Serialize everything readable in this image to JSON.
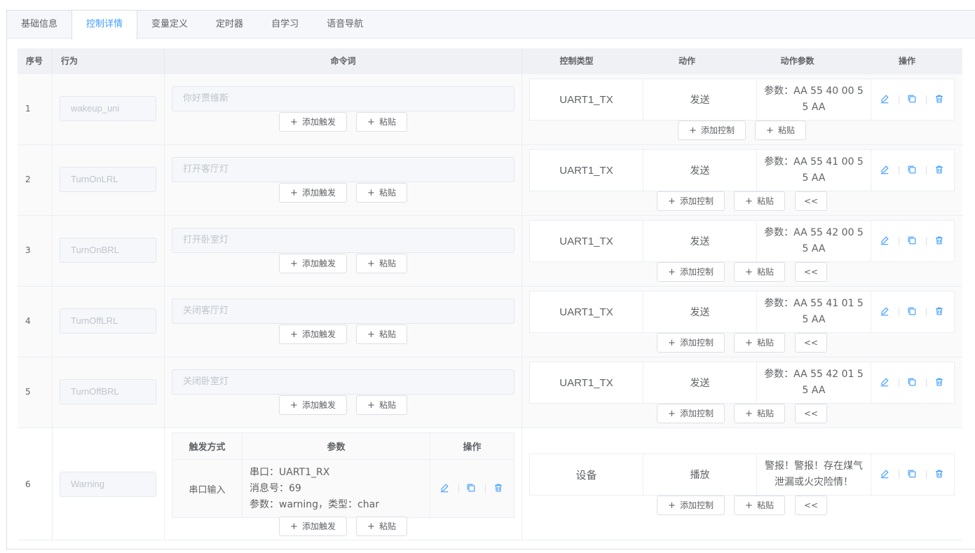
{
  "tabs": [
    "基础信息",
    "控制详情",
    "变量定义",
    "定时器",
    "自学习",
    "语音导航"
  ],
  "active_tab": 1,
  "table_headers": {
    "seq": "序号",
    "behavior": "行为",
    "command": "命令词",
    "control_type": "控制类型",
    "action": "动作",
    "action_params": "动作参数",
    "operations": "操作"
  },
  "buttons": {
    "add_trigger": "添加触发",
    "paste": "粘贴",
    "add_control": "添加控制",
    "collapse": "<<"
  },
  "rows": [
    {
      "seq": "1",
      "behavior": "wakeup_uni",
      "command": "你好贾维斯",
      "control_type": "UART1_TX",
      "action": "发送",
      "params": "参数：AA 55 40 00 5 5 AA"
    },
    {
      "seq": "2",
      "behavior": "TurnOnLRL",
      "command": "打开客厅灯",
      "control_type": "UART1_TX",
      "action": "发送",
      "params": "参数：AA 55 41 00 5 5 AA"
    },
    {
      "seq": "3",
      "behavior": "TurnOnBRL",
      "command": "打开卧室灯",
      "control_type": "UART1_TX",
      "action": "发送",
      "params": "参数：AA 55 42 00 5 5 AA"
    },
    {
      "seq": "4",
      "behavior": "TurnOffLRL",
      "command": "关闭客厅灯",
      "control_type": "UART1_TX",
      "action": "发送",
      "params": "参数：AA 55 41 01 5 5 AA"
    },
    {
      "seq": "5",
      "behavior": "TurnOffBRL",
      "command": "关闭卧室灯",
      "control_type": "UART1_TX",
      "action": "发送",
      "params": "参数：AA 55 42 01 5 5 AA"
    },
    {
      "seq": "6",
      "behavior": "Warning",
      "trigger_table": {
        "headers": [
          "触发方式",
          "参数",
          "操作"
        ],
        "mode": "串口输入",
        "param_lines": [
          "串口：UART1_RX",
          "消息号：69",
          "参数：warning，类型：char"
        ]
      },
      "control_type": "设备",
      "action": "播放",
      "params": "警报！警报！存在煤气泄漏或火灾险情！"
    }
  ]
}
